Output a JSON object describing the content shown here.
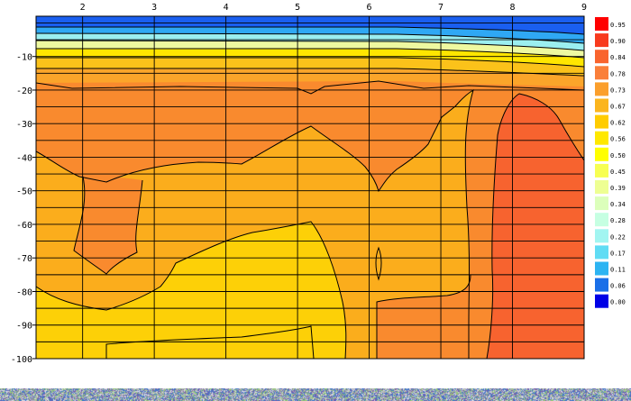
{
  "chart_data": {
    "type": "contour",
    "title": "",
    "xlabel": "",
    "ylabel": "",
    "x_ticks": [
      2,
      3,
      4,
      5,
      6,
      7,
      8,
      9
    ],
    "xlim": [
      1.35,
      9
    ],
    "y_ticks": [
      -10,
      -20,
      -30,
      -40,
      -50,
      -60,
      -70,
      -80,
      -90,
      -100
    ],
    "ylim": [
      -100,
      2
    ],
    "grid": true,
    "colorbar": {
      "placement": "right",
      "levels": [
        {
          "label": "0.95",
          "color": "#ff0000"
        },
        {
          "label": "0.90",
          "color": "#f83a1e"
        },
        {
          "label": "0.84",
          "color": "#f9642e"
        },
        {
          "label": "0.78",
          "color": "#fa7f3a"
        },
        {
          "label": "0.73",
          "color": "#fb9f2c"
        },
        {
          "label": "0.67",
          "color": "#fbb51e"
        },
        {
          "label": "0.62",
          "color": "#ffcc00"
        },
        {
          "label": "0.56",
          "color": "#ffe800"
        },
        {
          "label": "0.50",
          "color": "#ffff00"
        },
        {
          "label": "0.45",
          "color": "#f7ff52"
        },
        {
          "label": "0.39",
          "color": "#eeff93"
        },
        {
          "label": "0.34",
          "color": "#dcffbb"
        },
        {
          "label": "0.28",
          "color": "#c6ffe2"
        },
        {
          "label": "0.22",
          "color": "#a2f5f1"
        },
        {
          "label": "0.17",
          "color": "#60dcf4"
        },
        {
          "label": "0.11",
          "color": "#2db4f2"
        },
        {
          "label": "0.06",
          "color": "#1a6fe8"
        },
        {
          "label": "0.00",
          "color": "#0000e6"
        }
      ]
    }
  }
}
